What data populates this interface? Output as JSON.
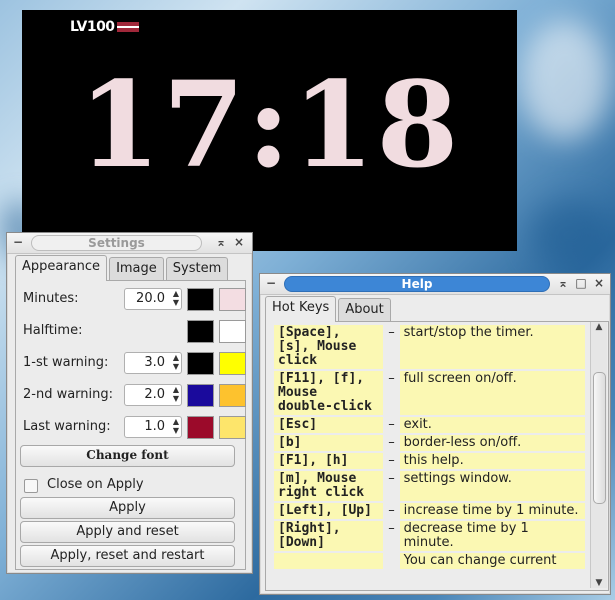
{
  "timer": {
    "logo": "LV100",
    "time": "17:18"
  },
  "settings": {
    "title": "Settings",
    "tabs": [
      "Appearance",
      "Image",
      "System"
    ],
    "rows": [
      {
        "label": "Minutes:",
        "value": "20.0",
        "color1": "#000000",
        "color2": "#f3dde2"
      },
      {
        "label": "Halftime:",
        "value": "",
        "color1": "#000000",
        "color2": "#ffffff"
      },
      {
        "label": "1-st warning:",
        "value": "3.0",
        "color1": "#000000",
        "color2": "#ffff00"
      },
      {
        "label": "2-nd warning:",
        "value": "2.0",
        "color1": "#1a0a9c",
        "color2": "#fdc22e"
      },
      {
        "label": "Last warning:",
        "value": "1.0",
        "color1": "#9b0a2a",
        "color2": "#fde56b"
      }
    ],
    "change_font": "Change font",
    "close_on_apply": "Close on Apply",
    "apply": "Apply",
    "apply_reset": "Apply and reset",
    "apply_reset_restart": "Apply, reset and restart"
  },
  "help": {
    "title": "Help",
    "tabs": [
      "Hot Keys",
      "About"
    ],
    "dash": "–",
    "rows": [
      {
        "key": "[Space], [s], Mouse click",
        "desc": "start/stop the timer."
      },
      {
        "key": "[F11], [f], Mouse double-click",
        "desc": "full screen on/off."
      },
      {
        "key": "[Esc]",
        "desc": "exit."
      },
      {
        "key": "[b]",
        "desc": "border-less on/off."
      },
      {
        "key": "[F1], [h]",
        "desc": "this help."
      },
      {
        "key": "[m], Mouse right click",
        "desc": "settings window."
      },
      {
        "key": "[Left], [Up]",
        "desc": "increase time by 1 minute."
      },
      {
        "key": "[Right], [Down]",
        "desc": "decrease time by 1 minute."
      },
      {
        "key": "",
        "desc": "You can change current"
      }
    ]
  }
}
